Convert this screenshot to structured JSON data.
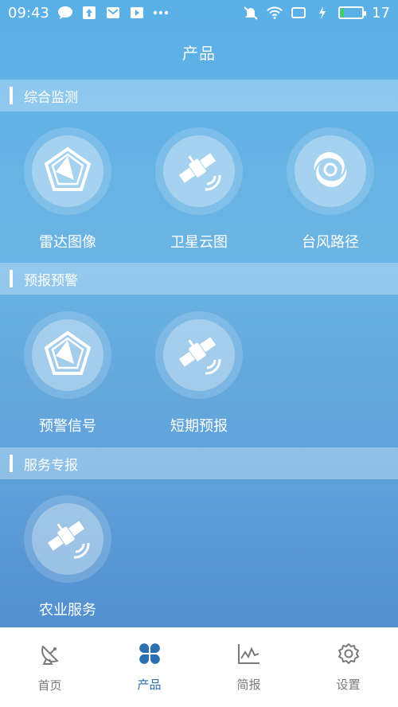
{
  "status_bar": {
    "time": "09:43",
    "battery_text": "17",
    "battery_level": 0.17,
    "icons": [
      "chat-icon",
      "upload-icon",
      "mail-icon",
      "play-icon",
      "more-dots-icon",
      "mute-icon",
      "wifi-icon",
      "screen-icon",
      "charging-icon",
      "battery-icon"
    ]
  },
  "header": {
    "title": "产品"
  },
  "sections": [
    {
      "title": "综合监测",
      "items": [
        {
          "label": "雷达图像",
          "icon": "radar-icon"
        },
        {
          "label": "卫星云图",
          "icon": "satellite-icon"
        },
        {
          "label": "台风路径",
          "icon": "typhoon-icon"
        }
      ]
    },
    {
      "title": "预报预警",
      "items": [
        {
          "label": "预警信号",
          "icon": "radar-icon"
        },
        {
          "label": "短期预报",
          "icon": "satellite-icon"
        }
      ]
    },
    {
      "title": "服务专报",
      "items": [
        {
          "label": "农业服务",
          "icon": "satellite-icon"
        }
      ]
    }
  ],
  "tab_bar": {
    "active": 1,
    "tabs": [
      {
        "label": "首页",
        "icon": "satellite-dish-icon"
      },
      {
        "label": "产品",
        "icon": "clover-icon"
      },
      {
        "label": "简报",
        "icon": "chart-line-icon"
      },
      {
        "label": "设置",
        "icon": "gear-icon"
      }
    ]
  },
  "colors": {
    "accent": "#2a6fb0",
    "tab_inactive": "#7a7a7a",
    "battery": "#3cd35a"
  }
}
